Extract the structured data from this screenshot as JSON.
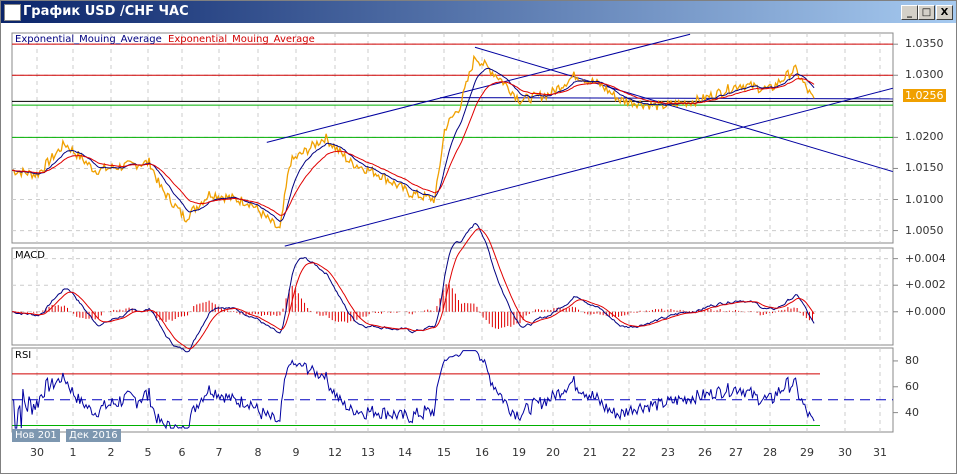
{
  "window": {
    "title": "График USD /CHF  ЧАС",
    "min": "_",
    "max": "□",
    "close": "X"
  },
  "legend": {
    "ema_fast": "Exponential_Mouing_Average",
    "ema_slow": "Exponential_Mouing_Average"
  },
  "panels": {
    "macd": "MACD",
    "rsi": "RSI"
  },
  "price_axis": [
    "1.0350",
    "1.0300",
    "1.0200",
    "1.0150",
    "1.0100",
    "1.0050"
  ],
  "macd_axis": [
    "+0.004",
    "+0.002",
    "+0.000"
  ],
  "rsi_axis": [
    "80",
    "60",
    "40"
  ],
  "current_price": "1.0256",
  "months": [
    "Нов 201",
    "Дек 2016"
  ],
  "days": [
    "30",
    "1",
    "2",
    "5",
    "6",
    "7",
    "8",
    "9",
    "12",
    "13",
    "14",
    "15",
    "16",
    "19",
    "20",
    "21",
    "22",
    "23",
    "26",
    "27",
    "28",
    "29",
    "30",
    "31"
  ],
  "colors": {
    "price": "#f0a000",
    "ema_fast": "#000080",
    "ema_slow": "#e00000",
    "hline_red": "#d00000",
    "hline_green": "#00b000",
    "trend": "#0000a0"
  },
  "chart_data": {
    "type": "line",
    "x_unit": "trading days from 30 Nov",
    "price_keypoints": [
      [
        -0.68,
        1.0147
      ],
      [
        0,
        1.014
      ],
      [
        0.76,
        1.019
      ],
      [
        1.58,
        1.0147
      ],
      [
        3.08,
        1.016
      ],
      [
        3.36,
        1.012
      ],
      [
        4.04,
        1.007
      ],
      [
        4.72,
        1.011
      ],
      [
        5.81,
        1.0095
      ],
      [
        6.63,
        1.005
      ],
      [
        6.9,
        1.016
      ],
      [
        7.86,
        1.02
      ],
      [
        8.54,
        1.016
      ],
      [
        9.36,
        1.014
      ],
      [
        10.18,
        1.011
      ],
      [
        10.86,
        1.01
      ],
      [
        11.13,
        1.0215
      ],
      [
        11.54,
        1.025
      ],
      [
        11.95,
        1.033
      ],
      [
        12.63,
        1.0295
      ],
      [
        13.18,
        1.026
      ],
      [
        14.0,
        1.027
      ],
      [
        14.68,
        1.03
      ],
      [
        15.36,
        1.0285
      ],
      [
        15.91,
        1.026
      ],
      [
        17.0,
        1.025
      ],
      [
        18.09,
        1.026
      ],
      [
        19.18,
        1.0285
      ],
      [
        20.0,
        1.0277
      ],
      [
        20.68,
        1.031
      ],
      [
        21.23,
        1.0256
      ]
    ],
    "ylim": [
      1.003,
      1.0368
    ],
    "hlines": {
      "red": [
        1.035,
        1.03
      ],
      "black": 1.0258,
      "green": [
        1.0252,
        1.02
      ]
    },
    "trendlines": [
      [
        [
          6.27,
          1.0192
        ],
        [
          17.82,
          1.0366
        ]
      ],
      [
        [
          6.76,
          1.0025
        ],
        [
          23.35,
          1.0279
        ]
      ],
      [
        [
          11.95,
          1.0345
        ],
        [
          23.35,
          1.0145
        ]
      ],
      [
        [
          11.0,
          1.0264
        ],
        [
          23.35,
          1.0262
        ]
      ]
    ],
    "macd_ylim": [
      -0.0025,
      0.0048
    ],
    "rsi_ylim": [
      25,
      90
    ],
    "rsi_levels": [
      70,
      50,
      30
    ]
  }
}
